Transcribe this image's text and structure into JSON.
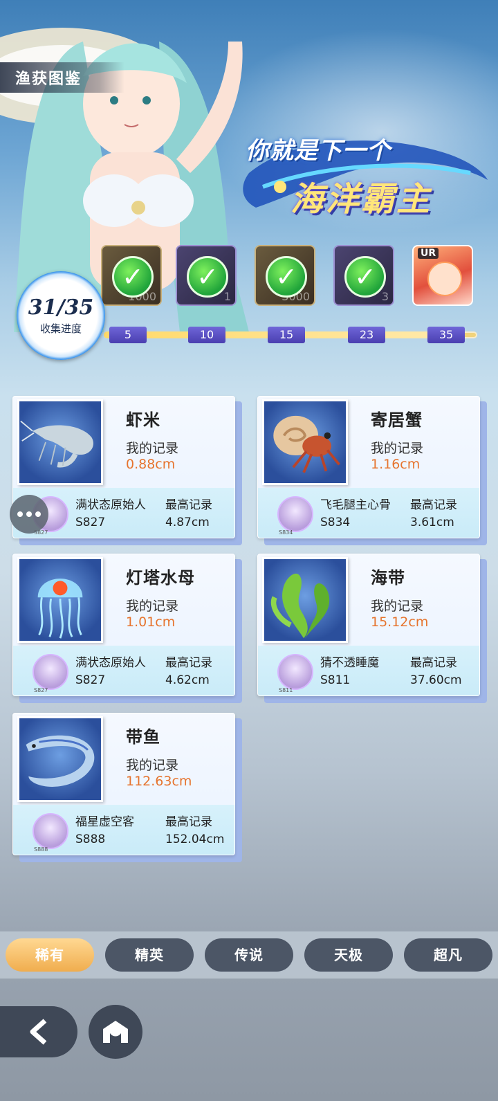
{
  "header": {
    "title": "渔获图鉴",
    "slogan_line1": "你就是下一个",
    "slogan_line2": "海洋霸主"
  },
  "progress": {
    "count": "31/35",
    "label": "收集进度",
    "fraction": 0.886
  },
  "milestones": [
    {
      "threshold": "5",
      "reward_amount": "1000",
      "claimed": true
    },
    {
      "threshold": "10",
      "reward_amount": "1",
      "claimed": true
    },
    {
      "threshold": "15",
      "reward_amount": "3000",
      "claimed": true
    },
    {
      "threshold": "23",
      "reward_amount": "3",
      "claimed": true
    },
    {
      "threshold": "35",
      "reward_tag": "UR",
      "claimed": false
    }
  ],
  "cards": [
    {
      "name": "虾米",
      "my_record_label": "我的记录",
      "my_record": "0.88cm",
      "holder": "满状态原始人",
      "server": "S827",
      "avatar_tag": "S827",
      "best_label": "最高记录",
      "best": "4.87cm",
      "icon": "shrimp-icon"
    },
    {
      "name": "寄居蟹",
      "my_record_label": "我的记录",
      "my_record": "1.16cm",
      "holder": "飞毛腿主心骨",
      "server": "S834",
      "avatar_tag": "S834",
      "best_label": "最高记录",
      "best": "3.61cm",
      "icon": "hermit-crab-icon"
    },
    {
      "name": "灯塔水母",
      "my_record_label": "我的记录",
      "my_record": "1.01cm",
      "holder": "满状态原始人",
      "server": "S827",
      "avatar_tag": "S827",
      "best_label": "最高记录",
      "best": "4.62cm",
      "icon": "jellyfish-icon"
    },
    {
      "name": "海带",
      "my_record_label": "我的记录",
      "my_record": "15.12cm",
      "holder": "猜不透睡魔",
      "server": "S811",
      "avatar_tag": "S811",
      "best_label": "最高记录",
      "best": "37.60cm",
      "icon": "kelp-icon"
    },
    {
      "name": "带鱼",
      "my_record_label": "我的记录",
      "my_record": "112.63cm",
      "holder": "福星虚空客",
      "server": "S888",
      "avatar_tag": "S888",
      "best_label": "最高记录",
      "best": "152.04cm",
      "icon": "ribbonfish-icon"
    }
  ],
  "tabs": [
    {
      "label": "稀有",
      "active": true
    },
    {
      "label": "精英",
      "active": false
    },
    {
      "label": "传说",
      "active": false
    },
    {
      "label": "天极",
      "active": false
    },
    {
      "label": "超凡",
      "active": false
    }
  ],
  "colors": {
    "accent_orange": "#e6742e",
    "tab_active": "#f0ad4e",
    "tab_inactive": "#4c5666",
    "milestone_badge": "#4a3fb0"
  }
}
